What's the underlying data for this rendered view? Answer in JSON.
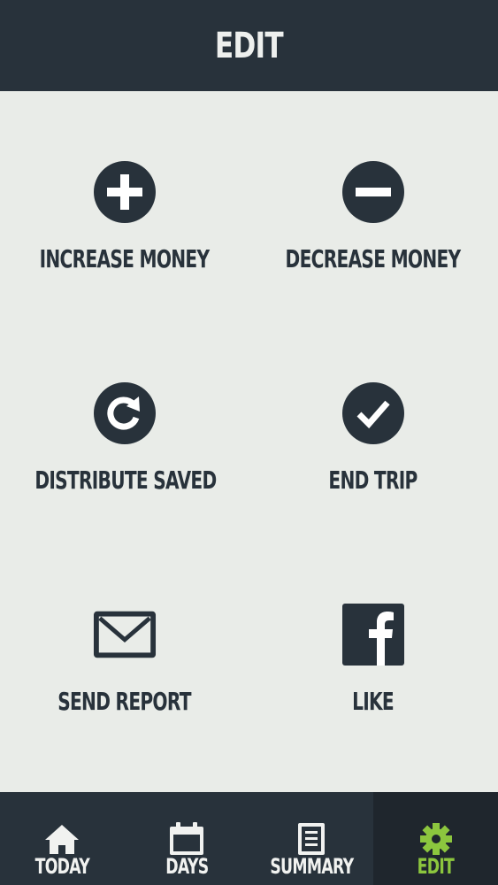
{
  "header": {
    "title": "EDIT"
  },
  "actions": [
    {
      "label": "INCREASE MONEY",
      "icon": "plus-circle-icon"
    },
    {
      "label": "DECREASE MONEY",
      "icon": "minus-circle-icon"
    },
    {
      "label": "DISTRIBUTE SAVED",
      "icon": "refresh-circle-icon"
    },
    {
      "label": "END TRIP",
      "icon": "check-circle-icon"
    },
    {
      "label": "SEND REPORT",
      "icon": "envelope-icon"
    },
    {
      "label": "LIKE",
      "icon": "facebook-icon"
    }
  ],
  "tabbar": {
    "tabs": [
      {
        "label": "TODAY",
        "icon": "home-icon"
      },
      {
        "label": "DAYS",
        "icon": "calendar-icon"
      },
      {
        "label": "SUMMARY",
        "icon": "document-icon"
      },
      {
        "label": "EDIT",
        "icon": "gear-icon"
      }
    ],
    "active_index": 3
  },
  "colors": {
    "header_bg": "#28323b",
    "page_bg": "#e9ece8",
    "icon_color": "#28323b",
    "active_tab": "#8cc63e"
  }
}
